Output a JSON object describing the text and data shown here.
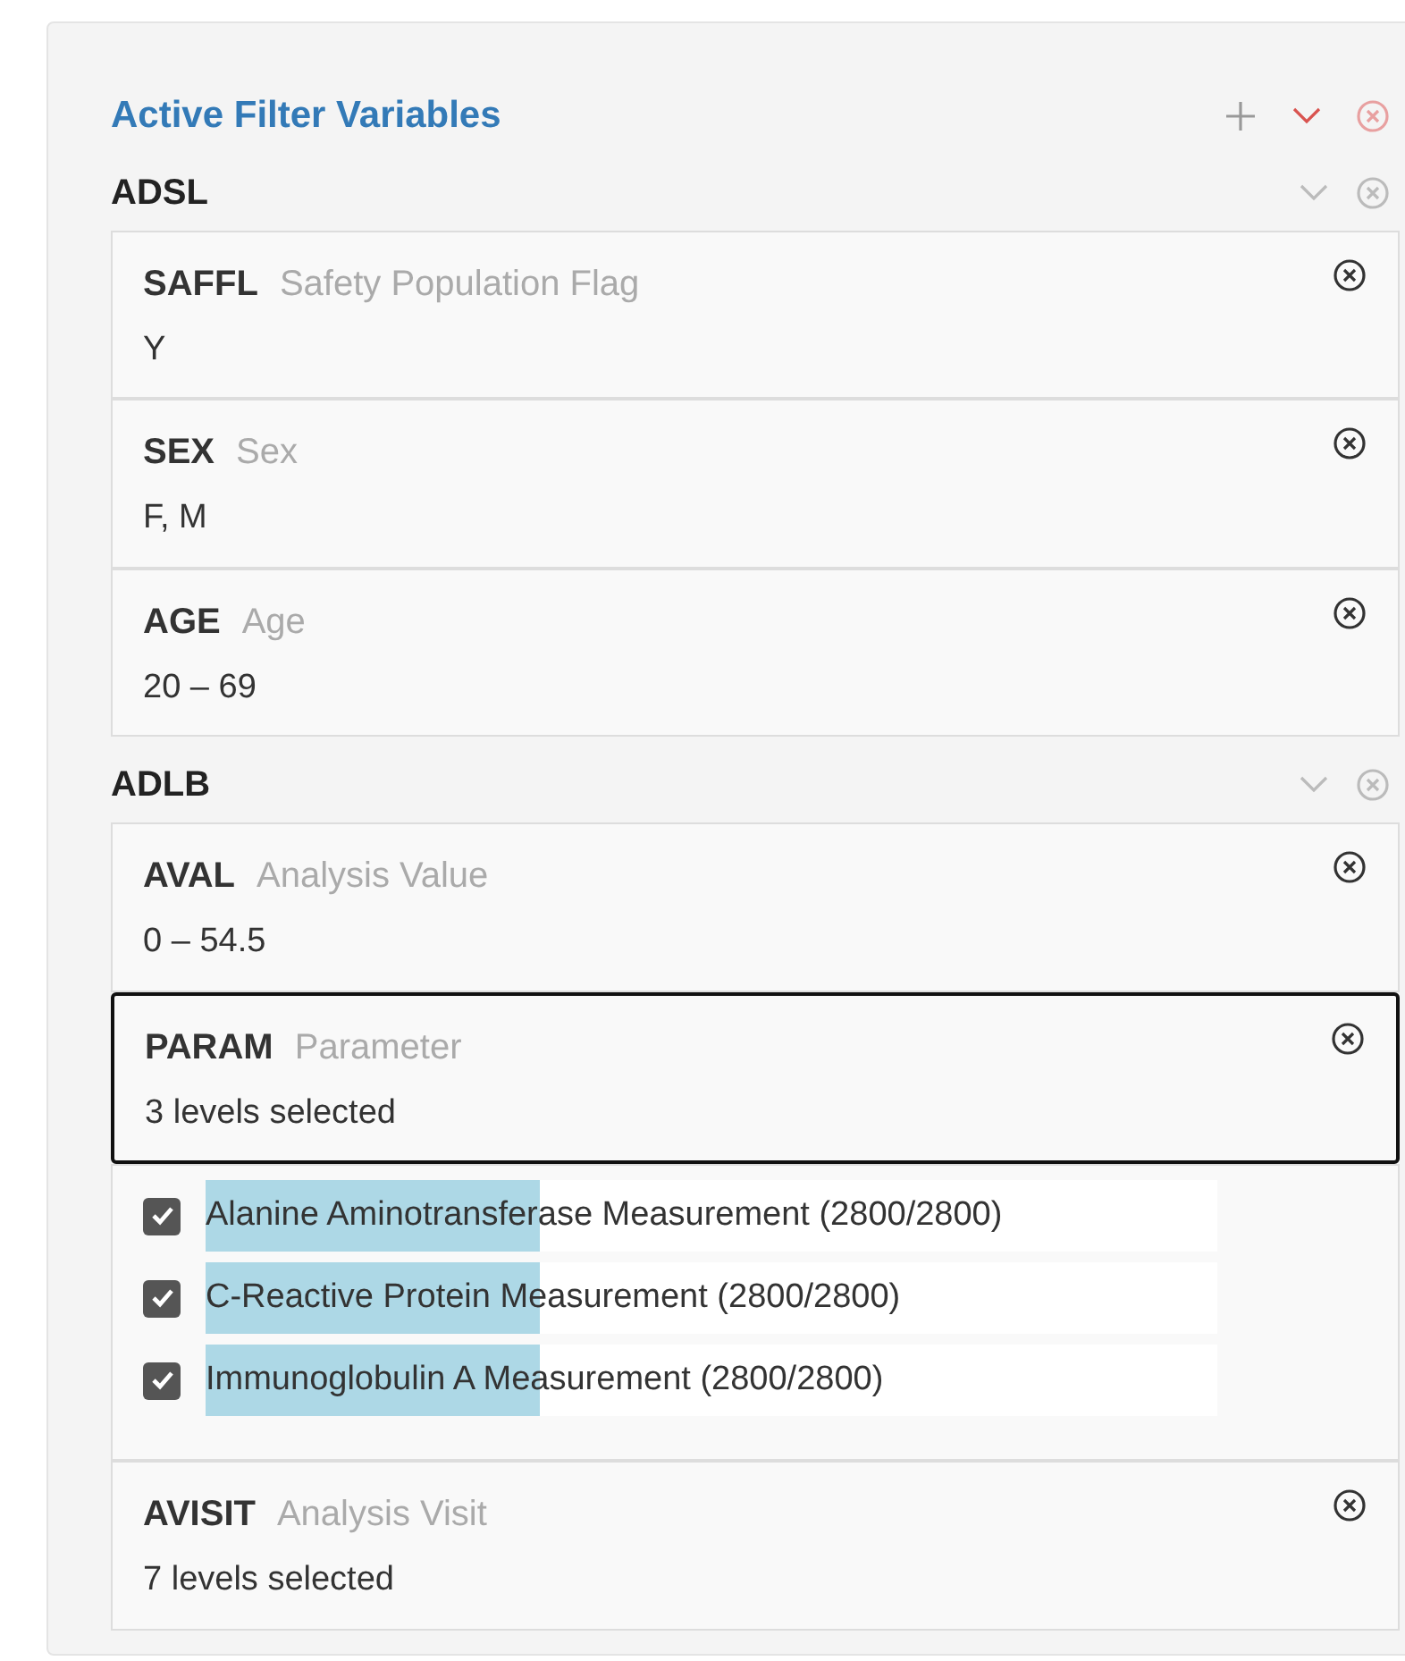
{
  "title": "Active Filter Variables",
  "datasets": [
    {
      "name": "ADSL",
      "filters": [
        {
          "code": "SAFFL",
          "label": "Safety Population Flag",
          "value": "Y",
          "selected": false
        },
        {
          "code": "SEX",
          "label": "Sex",
          "value": "F, M",
          "selected": false
        },
        {
          "code": "AGE",
          "label": "Age",
          "value": "20 – 69",
          "selected": false
        }
      ]
    },
    {
      "name": "ADLB",
      "filters": [
        {
          "code": "AVAL",
          "label": "Analysis Value",
          "value": "0 – 54.5",
          "selected": false
        },
        {
          "code": "PARAM",
          "label": "Parameter",
          "value": "3 levels selected",
          "selected": true,
          "options": [
            {
              "label": "Alanine Aminotransferase Measurement (2800/2800)",
              "checked": true,
              "level": 0.33
            },
            {
              "label": "C-Reactive Protein Measurement (2800/2800)",
              "checked": true,
              "level": 0.33
            },
            {
              "label": "Immunoglobulin A Measurement (2800/2800)",
              "checked": true,
              "level": 0.33
            }
          ]
        },
        {
          "code": "AVISIT",
          "label": "Analysis Visit",
          "value": "7 levels selected",
          "selected": false
        }
      ]
    }
  ]
}
